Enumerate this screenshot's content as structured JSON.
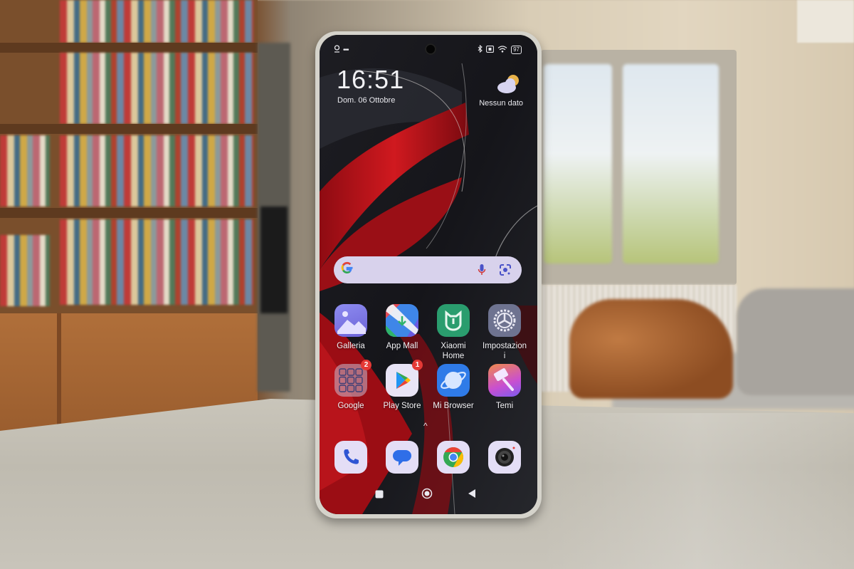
{
  "device": {
    "status_bar": {
      "left_icons": [
        "location-icon",
        "more-dots-icon"
      ],
      "right_icons": [
        "bluetooth-icon",
        "nfc-icon",
        "wifi-icon",
        "battery-icon"
      ],
      "battery_level": "97"
    },
    "clock_widget": {
      "time": "16:51",
      "date": "Dom. 06 Ottobre"
    },
    "weather_widget": {
      "icon": "partly-cloudy-icon",
      "text": "Nessun dato"
    },
    "search_bar": {
      "logo": "G",
      "icons": [
        "microphone-icon",
        "google-lens-icon"
      ]
    },
    "apps": [
      {
        "label": "Galleria",
        "icon": "gallery-icon",
        "badge": null
      },
      {
        "label": "App Mall",
        "icon": "app-mall-icon",
        "badge": null
      },
      {
        "label": "Xiaomi Home",
        "icon": "xiaomi-home-icon",
        "badge": null
      },
      {
        "label": "Impostazioni",
        "icon": "settings-icon",
        "badge": null
      },
      {
        "label": "Google",
        "icon": "google-folder-icon",
        "badge": "2"
      },
      {
        "label": "Play Store",
        "icon": "play-store-icon",
        "badge": "1"
      },
      {
        "label": "Mi Browser",
        "icon": "mi-browser-icon",
        "badge": null
      },
      {
        "label": "Temi",
        "icon": "themes-icon",
        "badge": null
      }
    ],
    "drawer_hint": "^",
    "dock": [
      {
        "name": "phone",
        "icon": "phone-icon"
      },
      {
        "name": "messages",
        "icon": "messages-icon"
      },
      {
        "name": "chrome",
        "icon": "chrome-icon"
      },
      {
        "name": "camera",
        "icon": "camera-icon"
      }
    ],
    "navigation": [
      "recents-button",
      "home-button",
      "back-button"
    ]
  },
  "colors": {
    "wallpaper_red": "#c4141c",
    "search_bg": "#d8d2ec",
    "badge": "#e53935",
    "dock_icon_bg": "#e4def6"
  }
}
